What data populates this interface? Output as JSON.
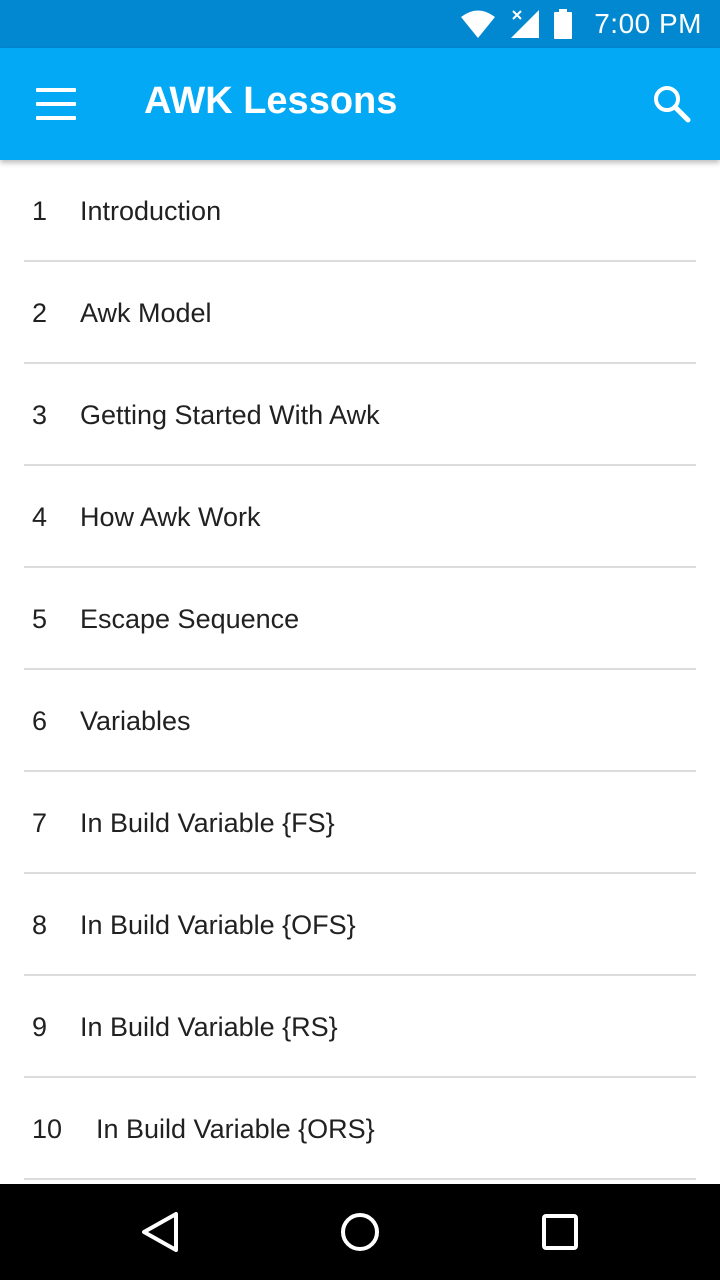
{
  "status_bar": {
    "time": "7:00 PM",
    "icons": [
      "wifi-icon",
      "signal-icon",
      "battery-icon"
    ]
  },
  "app_bar": {
    "title": "AWK Lessons",
    "menu_icon": "hamburger-menu-icon",
    "search_icon": "search-icon",
    "color": "#03a9f4",
    "status_color": "#0288d1"
  },
  "lessons": [
    {
      "num": "1",
      "title": "Introduction"
    },
    {
      "num": "2",
      "title": "Awk Model"
    },
    {
      "num": "3",
      "title": "Getting Started With Awk"
    },
    {
      "num": "4",
      "title": "How Awk Work"
    },
    {
      "num": "5",
      "title": "Escape Sequence"
    },
    {
      "num": "6",
      "title": "Variables"
    },
    {
      "num": "7",
      "title": "In Build Variable {FS}"
    },
    {
      "num": "8",
      "title": "In Build Variable {OFS}"
    },
    {
      "num": "9",
      "title": "In Build Variable {RS}"
    },
    {
      "num": "10",
      "title": "In Build Variable {ORS}"
    }
  ],
  "nav_bar": {
    "icons": [
      "back-icon",
      "home-icon",
      "recents-icon"
    ]
  }
}
